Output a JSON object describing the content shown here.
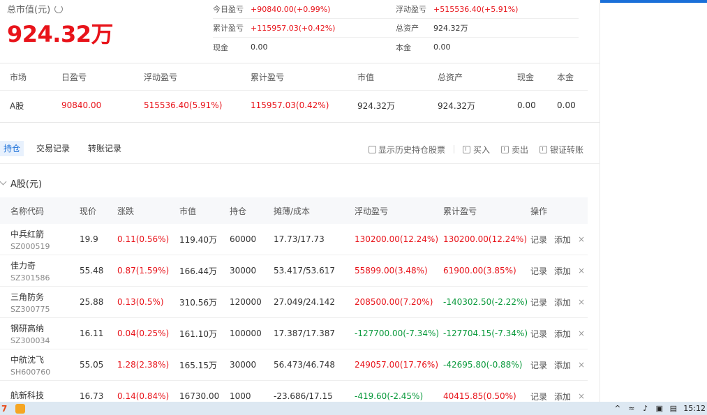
{
  "summary": {
    "total_label": "总市值(元)",
    "total_value": "924.32万",
    "rows": [
      [
        {
          "k": "今日盈亏",
          "v": "+90840.00(+0.99%)",
          "color": "red"
        },
        {
          "k": "浮动盈亏",
          "v": "+515536.40(+5.91%)",
          "color": "red"
        }
      ],
      [
        {
          "k": "累计盈亏",
          "v": "+115957.03(+0.42%)",
          "color": "red"
        },
        {
          "k": "总资产",
          "v": "924.32万",
          "color": ""
        }
      ],
      [
        {
          "k": "现金",
          "v": "0.00",
          "color": ""
        },
        {
          "k": "本金",
          "v": "0.00",
          "color": ""
        }
      ]
    ]
  },
  "market": {
    "headers": [
      "市场",
      "日盈亏",
      "浮动盈亏",
      "累计盈亏",
      "市值",
      "总资产",
      "现金",
      "本金"
    ],
    "row": [
      "A股",
      "90840.00",
      "515536.40(5.91%)",
      "115957.03(0.42%)",
      "924.32万",
      "924.32万",
      "0.00",
      "0.00"
    ],
    "row_colors": [
      "",
      "red",
      "red",
      "red",
      "",
      "",
      "",
      ""
    ]
  },
  "tabs": [
    "持仓",
    "交易记录",
    "转账记录"
  ],
  "actions": {
    "show_history": "显示历史持仓股票",
    "buy": "买入",
    "sell": "卖出",
    "transfer": "银证转账"
  },
  "group_label": "A股(元)",
  "table": {
    "headers": [
      "名称代码",
      "现价",
      "涨跌",
      "市值",
      "持仓",
      "摊薄/成本",
      "浮动盈亏",
      "累计盈亏",
      "操作"
    ],
    "op_record": "记录",
    "op_add": "添加",
    "rows": [
      {
        "name": "中兵红箭",
        "code": "SZ000519",
        "price": "19.9",
        "change": "0.11(0.56%)",
        "change_color": "red",
        "mv": "119.40万",
        "hold": "60000",
        "cost": "17.73/17.73",
        "float": "130200.00(12.24%)",
        "float_color": "red",
        "cum": "130200.00(12.24%)",
        "cum_color": "red"
      },
      {
        "name": "佳力奇",
        "code": "SZ301586",
        "price": "55.48",
        "change": "0.87(1.59%)",
        "change_color": "red",
        "mv": "166.44万",
        "hold": "30000",
        "cost": "53.417/53.617",
        "float": "55899.00(3.48%)",
        "float_color": "red",
        "cum": "61900.00(3.85%)",
        "cum_color": "red"
      },
      {
        "name": "三角防务",
        "code": "SZ300775",
        "price": "25.88",
        "change": "0.13(0.5%)",
        "change_color": "red",
        "mv": "310.56万",
        "hold": "120000",
        "cost": "27.049/24.142",
        "float": "208500.00(7.20%)",
        "float_color": "red",
        "cum": "-140302.50(-2.22%)",
        "cum_color": "green"
      },
      {
        "name": "钢研高纳",
        "code": "SZ300034",
        "price": "16.11",
        "change": "0.04(0.25%)",
        "change_color": "red",
        "mv": "161.10万",
        "hold": "100000",
        "cost": "17.387/17.387",
        "float": "-127700.00(-7.34%)",
        "float_color": "green",
        "cum": "-127704.15(-7.34%)",
        "cum_color": "green"
      },
      {
        "name": "中航沈飞",
        "code": "SH600760",
        "price": "55.05",
        "change": "1.28(2.38%)",
        "change_color": "red",
        "mv": "165.15万",
        "hold": "30000",
        "cost": "56.473/46.748",
        "float": "249057.00(17.76%)",
        "float_color": "red",
        "cum": "-42695.80(-0.88%)",
        "cum_color": "green"
      },
      {
        "name": "航新科技",
        "code": "",
        "price": "16.73",
        "change": "0.14(0.84%)",
        "change_color": "red",
        "mv": "16730.00",
        "hold": "1000",
        "cost": "-23.686/17.15",
        "float": "-419.60(-2.45%)",
        "float_color": "green",
        "cum": "40415.85(0.50%)",
        "cum_color": "red"
      }
    ]
  },
  "taskbar": {
    "time": "15:12"
  }
}
